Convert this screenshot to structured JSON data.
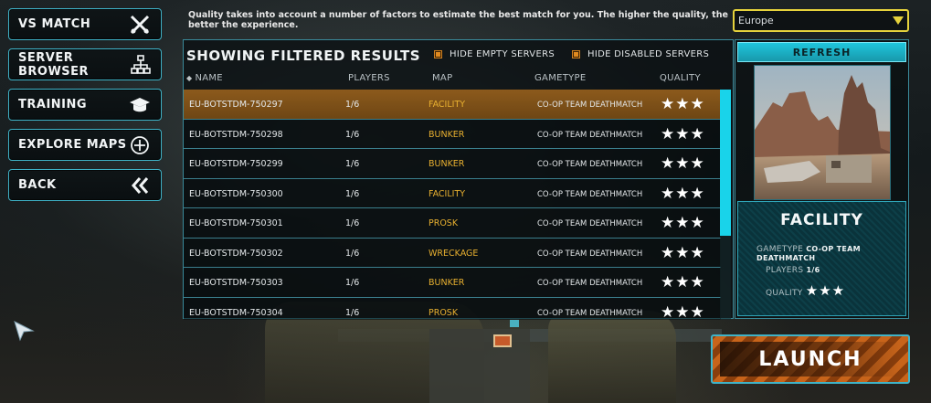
{
  "nav": {
    "items": [
      {
        "label": "VS MATCH",
        "icon": "crossed-swords-icon"
      },
      {
        "label": "SERVER BROWSER",
        "icon": "network-tree-icon"
      },
      {
        "label": "TRAINING",
        "icon": "graduation-cap-icon"
      },
      {
        "label": "EXPLORE MAPS",
        "icon": "crosshair-icon"
      },
      {
        "label": "BACK",
        "icon": "double-chevron-left-icon"
      }
    ]
  },
  "info_text": "Quality takes into account a number of factors to estimate the best match for you. The higher the quality, the better the experience.",
  "region": {
    "selected": "Europe"
  },
  "results": {
    "title": "SHOWING FILTERED RESULTS",
    "hide_empty": "HIDE EMPTY SERVERS",
    "hide_disabled": "HIDE DISABLED SERVERS",
    "columns": {
      "name": "NAME",
      "players": "PLAYERS",
      "map": "MAP",
      "gametype": "GAMETYPE",
      "quality": "QUALITY"
    },
    "rows": [
      {
        "name": "EU-BOTSTDM-750297",
        "players": "1/6",
        "map": "FACILITY",
        "gametype": "CO-OP TEAM DEATHMATCH",
        "quality": "★★★"
      },
      {
        "name": "EU-BOTSTDM-750298",
        "players": "1/6",
        "map": "BUNKER",
        "gametype": "CO-OP TEAM DEATHMATCH",
        "quality": "★★★"
      },
      {
        "name": "EU-BOTSTDM-750299",
        "players": "1/6",
        "map": "BUNKER",
        "gametype": "CO-OP TEAM DEATHMATCH",
        "quality": "★★★"
      },
      {
        "name": "EU-BOTSTDM-750300",
        "players": "1/6",
        "map": "FACILITY",
        "gametype": "CO-OP TEAM DEATHMATCH",
        "quality": "★★★"
      },
      {
        "name": "EU-BOTSTDM-750301",
        "players": "1/6",
        "map": "PROSK",
        "gametype": "CO-OP TEAM DEATHMATCH",
        "quality": "★★★"
      },
      {
        "name": "EU-BOTSTDM-750302",
        "players": "1/6",
        "map": "WRECKAGE",
        "gametype": "CO-OP TEAM DEATHMATCH",
        "quality": "★★★"
      },
      {
        "name": "EU-BOTSTDM-750303",
        "players": "1/6",
        "map": "BUNKER",
        "gametype": "CO-OP TEAM DEATHMATCH",
        "quality": "★★★"
      },
      {
        "name": "EU-BOTSTDM-750304",
        "players": "1/6",
        "map": "PROSK",
        "gametype": "CO-OP TEAM DEATHMATCH",
        "quality": "★★★"
      }
    ]
  },
  "preview": {
    "refresh_label": "REFRESH",
    "map_name": "FACILITY",
    "gametype_label": "GAMETYPE",
    "gametype_value": "CO-OP TEAM DEATHMATCH",
    "players_label": "PLAYERS",
    "players_value": "1/6",
    "quality_label": "QUALITY",
    "quality_value": "★★★"
  },
  "launch_label": "LAUNCH",
  "colors": {
    "accent": "#3fb3c8",
    "highlight": "#e6d23c",
    "map_text": "#e8b030",
    "selected_row": "#8c5a1c"
  }
}
